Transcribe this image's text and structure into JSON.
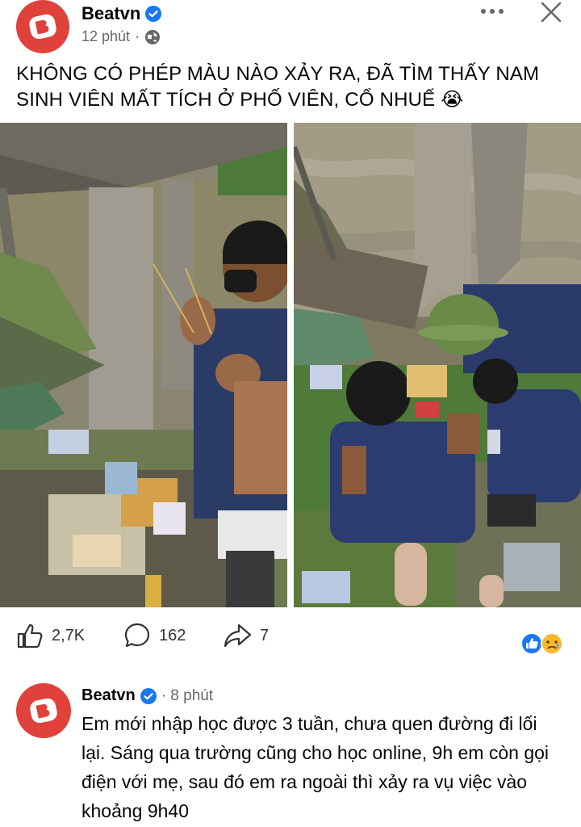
{
  "post": {
    "author": "Beatvn",
    "time": "12 phút",
    "separator": "·",
    "text": "KHÔNG CÓ PHÉP MÀU NÀO XẢY RA, ĐÃ TÌM THẤY NAM SINH VIÊN MẤT TÍCH Ở PHỐ VIÊN, CỔ NHUẾ 😭",
    "icons": {
      "privacy": "globe-icon",
      "more": "more-dots-icon",
      "close": "close-icon"
    }
  },
  "photos": [
    {
      "name": "photo-left",
      "description_icon": "photo"
    },
    {
      "name": "photo-right",
      "description_icon": "photo"
    }
  ],
  "actions": {
    "likes": "2,7K",
    "comments": "162",
    "shares": "7"
  },
  "comment": {
    "author": "Beatvn",
    "time": "· 8 phút",
    "text": "Em mới nhập học được 3 tuần, chưa quen đường đi lối lại. Sáng qua trường cũng cho học online, 9h em còn gọi điện với mẹ, sau đó em ra ngoài thì xảy ra vụ việc vào khoảng 9h40"
  },
  "colors": {
    "brand": "#e0413a",
    "verified": "#1877f2",
    "like": "#1877f2"
  }
}
